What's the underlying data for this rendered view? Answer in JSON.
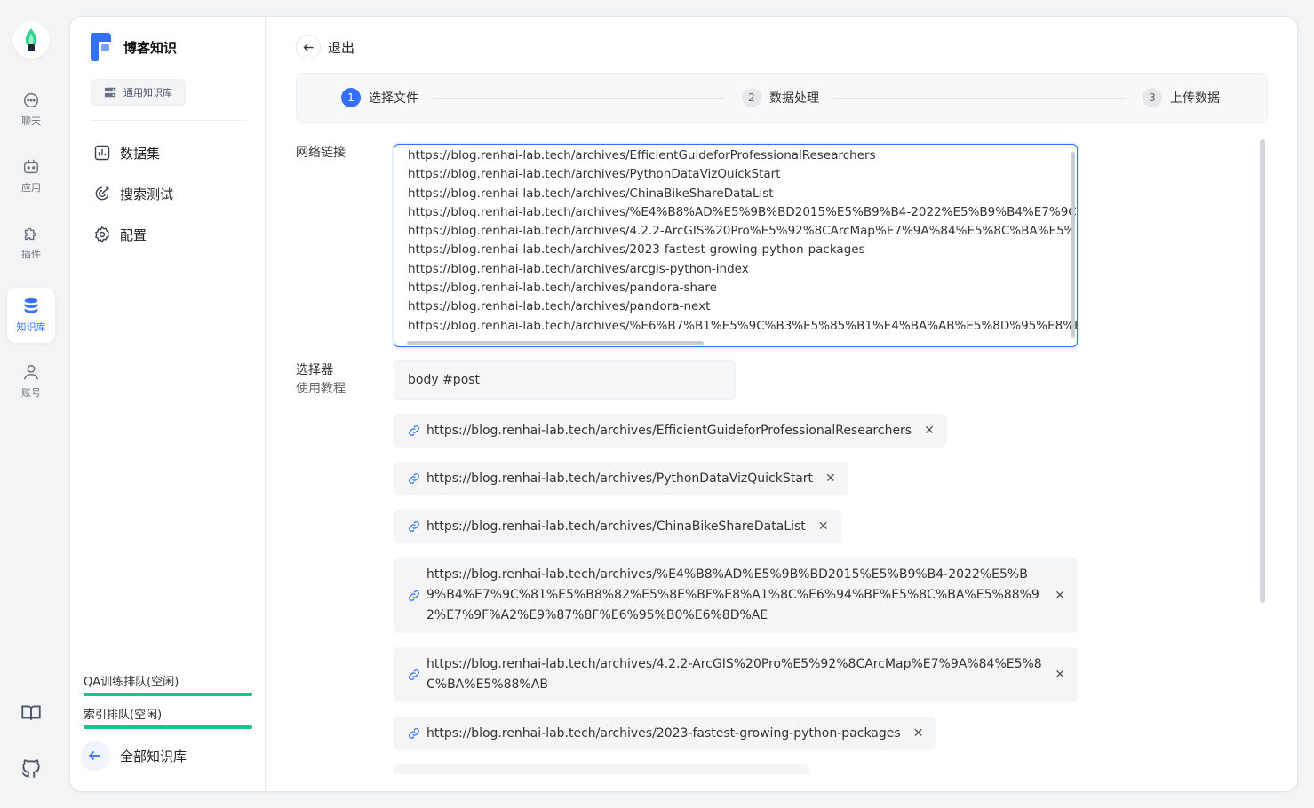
{
  "rail": {
    "items": [
      {
        "label": "聊天",
        "icon": "chat-icon"
      },
      {
        "label": "应用",
        "icon": "robot-icon"
      },
      {
        "label": "插件",
        "icon": "puzzle-icon"
      },
      {
        "label": "知识库",
        "icon": "database-icon"
      },
      {
        "label": "账号",
        "icon": "user-icon"
      }
    ]
  },
  "sidebar": {
    "title": "博客知识",
    "tag": "通用知识库",
    "nav": [
      {
        "label": "数据集",
        "icon": "chart-icon"
      },
      {
        "label": "搜索测试",
        "icon": "target-icon"
      },
      {
        "label": "配置",
        "icon": "gear-icon"
      }
    ],
    "queues": [
      {
        "label": "QA训练排队(空闲)",
        "progress": 100
      },
      {
        "label": "索引排队(空闲)",
        "progress": 100
      }
    ],
    "all_kb": "全部知识库"
  },
  "header": {
    "back_label": "退出"
  },
  "steps": [
    {
      "num": "1",
      "label": "选择文件"
    },
    {
      "num": "2",
      "label": "数据处理"
    },
    {
      "num": "3",
      "label": "上传数据"
    }
  ],
  "form": {
    "urls_label": "网络链接",
    "urls_lines": [
      "https://blog.renhai-lab.tech/archives/EfficientGuideforProfessionalResearchers",
      "https://blog.renhai-lab.tech/archives/PythonDataVizQuickStart",
      "https://blog.renhai-lab.tech/archives/ChinaBikeShareDataList",
      "https://blog.renhai-lab.tech/archives/%E4%B8%AD%E5%9B%BD2015%E5%B9%B4-2022%E5%B9%B4%E7%9C%",
      "https://blog.renhai-lab.tech/archives/4.2.2-ArcGIS%20Pro%E5%92%8CArcMap%E7%9A%84%E5%8C%BA%E5%",
      "https://blog.renhai-lab.tech/archives/2023-fastest-growing-python-packages",
      "https://blog.renhai-lab.tech/archives/arcgis-python-index",
      "https://blog.renhai-lab.tech/archives/pandora-share",
      "https://blog.renhai-lab.tech/archives/pandora-next",
      "https://blog.renhai-lab.tech/archives/%E6%B7%B1%E5%9C%B3%E5%85%B1%E4%BA%AB%E5%8D%95%E8%E"
    ],
    "selector_label": "选择器",
    "selector_help": "使用教程",
    "selector_value": "body #post"
  },
  "links": [
    "https://blog.renhai-lab.tech/archives/EfficientGuideforProfessionalResearchers",
    "https://blog.renhai-lab.tech/archives/PythonDataVizQuickStart",
    "https://blog.renhai-lab.tech/archives/ChinaBikeShareDataList",
    "https://blog.renhai-lab.tech/archives/%E4%B8%AD%E5%9B%BD2015%E5%B9%B4-2022%E5%B9%B4%E7%9C%81%E5%B8%82%E5%8E%BF%E8%A1%8C%E6%94%BF%E5%8C%BA%E5%88%92%E7%9F%A2%E9%87%8F%E6%95%B0%E6%8D%AE",
    "https://blog.renhai-lab.tech/archives/4.2.2-ArcGIS%20Pro%E5%92%8CArcMap%E7%9A%84%E5%8C%BA%E5%88%AB",
    "https://blog.renhai-lab.tech/archives/2023-fastest-growing-python-packages"
  ],
  "colors": {
    "accent": "#3370ff",
    "queue": "#13c58f"
  }
}
